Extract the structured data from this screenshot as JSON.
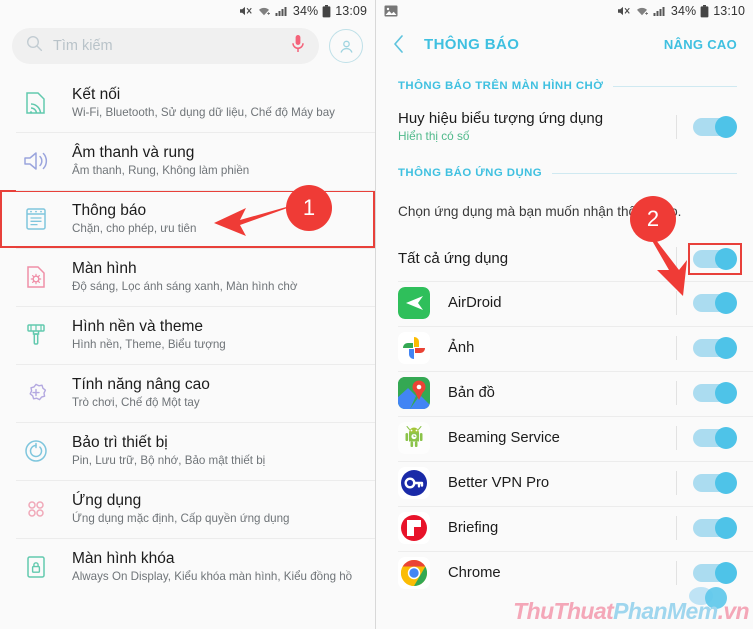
{
  "left": {
    "statusbar": {
      "icons": [
        "mute-icon",
        "wifi-icon",
        "signal-icon"
      ],
      "battery_percent": "34%",
      "time": "13:09"
    },
    "search": {
      "placeholder": "Tìm kiếm",
      "mic_icon": "microphone-icon",
      "search_icon": "search-icon",
      "avatar_icon": "account-icon"
    },
    "items": [
      {
        "icon": "connections-icon",
        "title": "Kết nối",
        "subtitle": "Wi-Fi, Bluetooth, Sử dụng dữ liệu, Chế độ Máy bay",
        "highlighted": false
      },
      {
        "icon": "sound-icon",
        "title": "Âm thanh và rung",
        "subtitle": "Âm thanh, Rung, Không làm phiền",
        "highlighted": false
      },
      {
        "icon": "notifications-icon",
        "title": "Thông báo",
        "subtitle": "Chặn, cho phép, ưu tiên",
        "highlighted": true
      },
      {
        "icon": "display-icon",
        "title": "Màn hình",
        "subtitle": "Độ sáng, Lọc ánh sáng xanh, Màn hình chờ",
        "highlighted": false
      },
      {
        "icon": "wallpaper-icon",
        "title": "Hình nền và theme",
        "subtitle": "Hình nền, Theme, Biểu tượng",
        "highlighted": false
      },
      {
        "icon": "advanced-features-icon",
        "title": "Tính năng nâng cao",
        "subtitle": "Trò chơi, Chế độ Một tay",
        "highlighted": false
      },
      {
        "icon": "device-maintenance-icon",
        "title": "Bảo trì thiết bị",
        "subtitle": "Pin, Lưu trữ, Bộ nhớ, Bảo mật thiết bị",
        "highlighted": false
      },
      {
        "icon": "apps-icon",
        "title": "Ứng dụng",
        "subtitle": "Ứng dụng mặc định, Cấp quyền ứng dụng",
        "highlighted": false
      },
      {
        "icon": "lockscreen-icon",
        "title": "Màn hình khóa",
        "subtitle": "Always On Display, Kiểu khóa màn hình, Kiểu đồng hồ",
        "highlighted": false
      }
    ]
  },
  "right": {
    "statusbar": {
      "left_icon": "image-icon",
      "icons": [
        "mute-icon",
        "wifi-icon",
        "signal-icon"
      ],
      "battery_percent": "34%",
      "time": "13:10"
    },
    "header": {
      "back_icon": "back-chevron-icon",
      "title": "THÔNG BÁO",
      "action": "NÂNG CAO"
    },
    "section1": {
      "label": "THÔNG BÁO TRÊN MÀN HÌNH CHỜ",
      "row": {
        "title": "Huy hiệu biểu tượng ứng dụng",
        "subtitle": "Hiển thị có số",
        "toggle_on": true
      }
    },
    "section2": {
      "label": "THÔNG BÁO ỨNG DỤNG",
      "description": "Chọn ứng dụng mà bạn muốn nhận thông báo.",
      "all_apps": {
        "title": "Tất cả ứng dụng",
        "toggle_on": true,
        "highlighted": true
      }
    },
    "apps": [
      {
        "icon": "airdroid-icon",
        "name": "AirDroid",
        "toggle_on": true
      },
      {
        "icon": "google-photos-icon",
        "name": "Ảnh",
        "toggle_on": true
      },
      {
        "icon": "google-maps-icon",
        "name": "Bản đồ",
        "toggle_on": true
      },
      {
        "icon": "android-beam-icon",
        "name": "Beaming Service",
        "toggle_on": true
      },
      {
        "icon": "better-vpn-pro-icon",
        "name": "Better VPN Pro",
        "toggle_on": true
      },
      {
        "icon": "briefing-icon",
        "name": "Briefing",
        "toggle_on": true
      },
      {
        "icon": "chrome-icon",
        "name": "Chrome",
        "toggle_on": true
      }
    ]
  },
  "annotations": {
    "step1": "1",
    "step2": "2",
    "arrow_color": "#ef3b36"
  },
  "watermark": {
    "part1": "ThuThuat",
    "part2": "PhanMem",
    "part3": ".vn"
  },
  "colors": {
    "accent": "#3fc0e0",
    "toggle_knob": "#4ec3e8",
    "toggle_track": "#abdcf0",
    "annotation_red": "#ef3b36",
    "subtitle_green": "#4fb98a"
  }
}
